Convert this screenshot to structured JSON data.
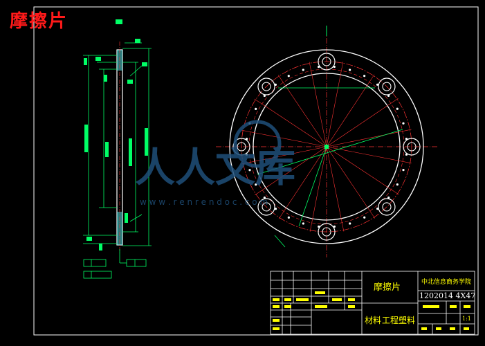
{
  "drawing": {
    "title": "摩擦片",
    "watermark_text": "人人文库",
    "watermark_url": "w w w . r e n r e n d o c . c o m",
    "background": "#000000",
    "colors": {
      "frame": "#ffffff",
      "dimension": "#00ff66",
      "centerline": "#ff3333",
      "watermark": "#1f4f7a",
      "title_red": "#ff1a1a",
      "title_yellow": "#ffff00",
      "outline": "#ffffff"
    }
  },
  "title_block": {
    "part_name": "摩擦片",
    "school": "中北信息商务学院",
    "drawing_number": "1202014 4X47",
    "material_label": "材料",
    "material_value": "工程塑料",
    "scale_value": "1:1"
  },
  "icons": [
    "section-marker-icon",
    "center-mark-icon",
    "leader-arrow-icon"
  ]
}
